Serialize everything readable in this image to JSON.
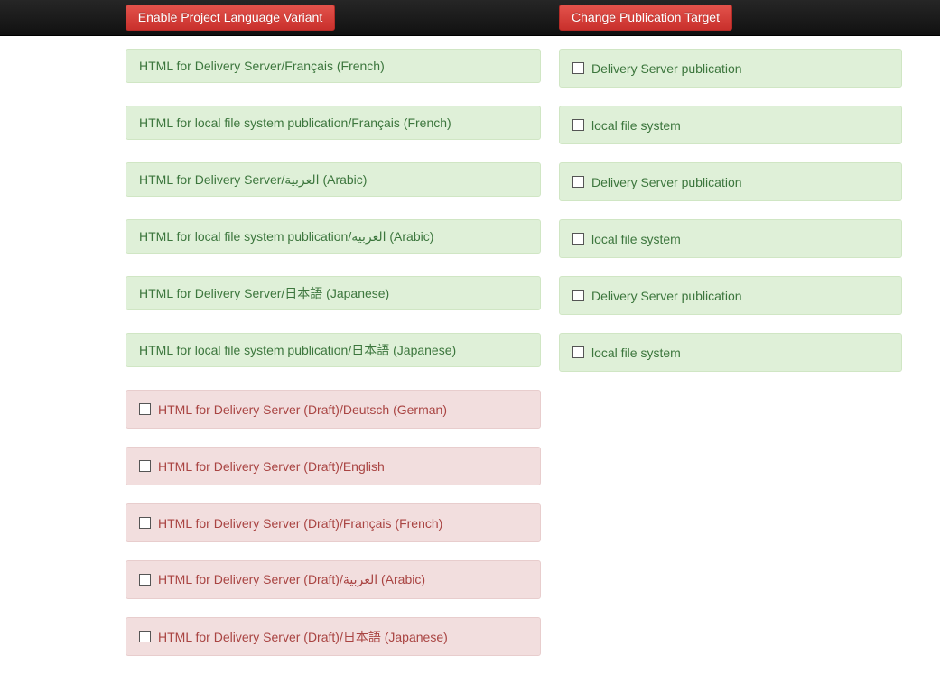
{
  "toolbar": {
    "enable_variant_label": "Enable Project Language Variant",
    "change_target_label": "Change Publication Target"
  },
  "variants": [
    {
      "label": "HTML for Delivery Server/Français (French)",
      "status": "success",
      "checkbox": false
    },
    {
      "label": "HTML for local file system publication/Français (French)",
      "status": "success",
      "checkbox": false
    },
    {
      "label": "HTML for Delivery Server/العربية (Arabic)",
      "status": "success",
      "checkbox": false
    },
    {
      "label": "HTML for local file system publication/العربية (Arabic)",
      "status": "success",
      "checkbox": false
    },
    {
      "label": "HTML for Delivery Server/日本語 (Japanese)",
      "status": "success",
      "checkbox": false
    },
    {
      "label": "HTML for local file system publication/日本語 (Japanese)",
      "status": "success",
      "checkbox": false
    },
    {
      "label": "HTML for Delivery Server (Draft)/Deutsch (German)",
      "status": "danger",
      "checkbox": true
    },
    {
      "label": "HTML for Delivery Server (Draft)/English",
      "status": "danger",
      "checkbox": true
    },
    {
      "label": "HTML for Delivery Server (Draft)/Français (French)",
      "status": "danger",
      "checkbox": true
    },
    {
      "label": "HTML for Delivery Server (Draft)/العربية (Arabic)",
      "status": "danger",
      "checkbox": true
    },
    {
      "label": "HTML for Delivery Server (Draft)/日本語 (Japanese)",
      "status": "danger",
      "checkbox": true
    }
  ],
  "targets": [
    {
      "label": "Delivery Server publication",
      "status": "success",
      "checkbox": true
    },
    {
      "label": "local file system",
      "status": "success",
      "checkbox": true
    },
    {
      "label": "Delivery Server publication",
      "status": "success",
      "checkbox": true
    },
    {
      "label": "local file system",
      "status": "success",
      "checkbox": true
    },
    {
      "label": "Delivery Server publication",
      "status": "success",
      "checkbox": true
    },
    {
      "label": "local file system",
      "status": "success",
      "checkbox": true
    }
  ],
  "colors": {
    "success_bg": "#dff0d8",
    "success_text": "#3c763d",
    "danger_bg": "#f2dede",
    "danger_text": "#a94442",
    "button_red": "#d9534f",
    "topbar": "#1b1b1b"
  }
}
